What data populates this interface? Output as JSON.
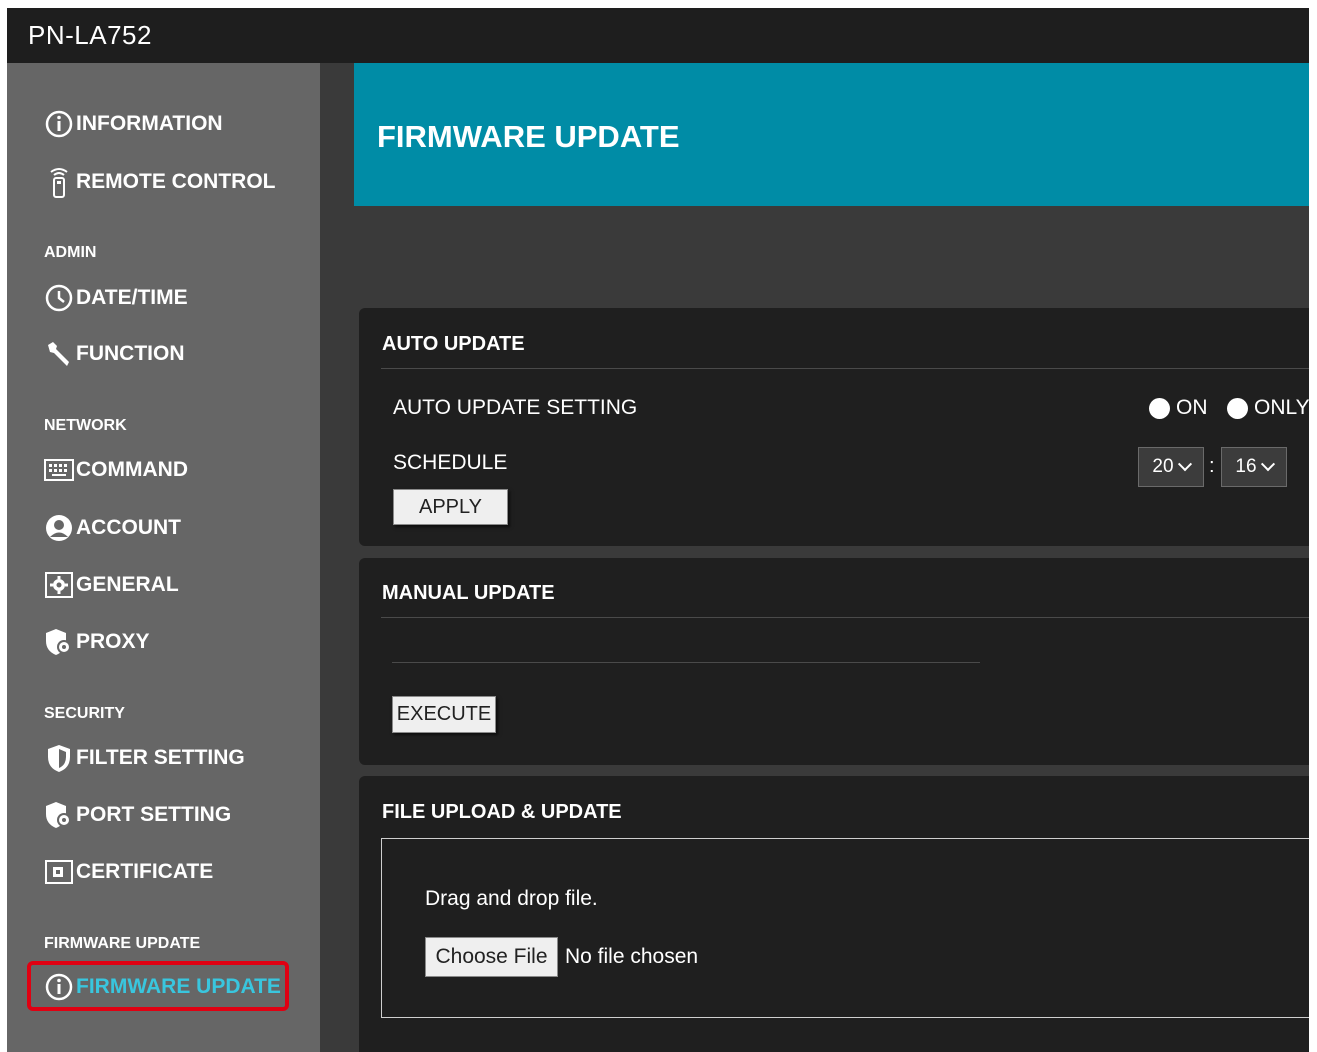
{
  "app": {
    "title": "PN-LA752"
  },
  "sidebar": {
    "items": [
      {
        "label": "INFORMATION",
        "icon": "info-icon"
      },
      {
        "label": "REMOTE CONTROL",
        "icon": "remote-icon"
      }
    ],
    "sections": [
      {
        "label": "ADMIN",
        "items": [
          {
            "label": "DATE/TIME",
            "icon": "clock-icon"
          },
          {
            "label": "FUNCTION",
            "icon": "wrench-icon"
          }
        ]
      },
      {
        "label": "NETWORK",
        "items": [
          {
            "label": "COMMAND",
            "icon": "keyboard-icon"
          },
          {
            "label": "ACCOUNT",
            "icon": "user-icon"
          },
          {
            "label": "GENERAL",
            "icon": "gear-icon"
          },
          {
            "label": "PROXY",
            "icon": "shield-gear-icon"
          }
        ]
      },
      {
        "label": "SECURITY",
        "items": [
          {
            "label": "FILTER SETTING",
            "icon": "shield-icon"
          },
          {
            "label": "PORT SETTING",
            "icon": "shield-gear-icon"
          },
          {
            "label": "CERTIFICATE",
            "icon": "certificate-icon"
          }
        ]
      },
      {
        "label": "FIRMWARE UPDATE",
        "items": [
          {
            "label": "FIRMWARE UPDATE",
            "icon": "info-icon",
            "active": true
          }
        ]
      }
    ],
    "active_color": "#39c6de",
    "highlight_color": "#e00012"
  },
  "page": {
    "title": "FIRMWARE UPDATE",
    "banner_color": "#008ca6"
  },
  "auto_update": {
    "title": "AUTO UPDATE",
    "setting_label": "AUTO UPDATE SETTING",
    "options": [
      "ON",
      "ONLY"
    ],
    "schedule_label": "SCHEDULE",
    "hour": "20",
    "separator": ":",
    "minute": "16",
    "apply_label": "APPLY"
  },
  "manual_update": {
    "title": "MANUAL UPDATE",
    "execute_label": "EXECUTE"
  },
  "file_upload": {
    "title": "FILE UPLOAD & UPDATE",
    "drop_text": "Drag and drop file.",
    "choose_label": "Choose File",
    "status": "No file chosen"
  }
}
